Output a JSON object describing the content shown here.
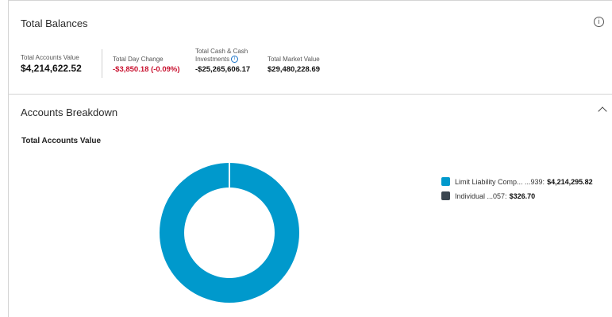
{
  "balances": {
    "title": "Total Balances",
    "metrics": [
      {
        "label": "Total Accounts Value",
        "value": "$4,214,622.52"
      },
      {
        "label": "Total Day Change",
        "value": "-$3,850.18 (-0.09%)",
        "color": "#c8102e"
      },
      {
        "label_line1": "Total Cash & Cash",
        "label_line2": "Investments",
        "value": "-$25,265,606.17"
      },
      {
        "label": "Total Market Value",
        "value": "$29,480,228.69"
      }
    ]
  },
  "breakdown": {
    "title": "Accounts Breakdown",
    "chart_title": "Total Accounts Value"
  },
  "chart_data": {
    "type": "pie",
    "donut": true,
    "title": "Total Accounts Value",
    "series": [
      {
        "name": "Limit Liability Comp... ...939",
        "value": 4214295.82,
        "value_label": "$4,214,295.82",
        "color": "#0099cc"
      },
      {
        "name": "Individual ...057",
        "value": 326.7,
        "value_label": "$326.70",
        "color": "#3b4650"
      }
    ],
    "legend": "right"
  }
}
